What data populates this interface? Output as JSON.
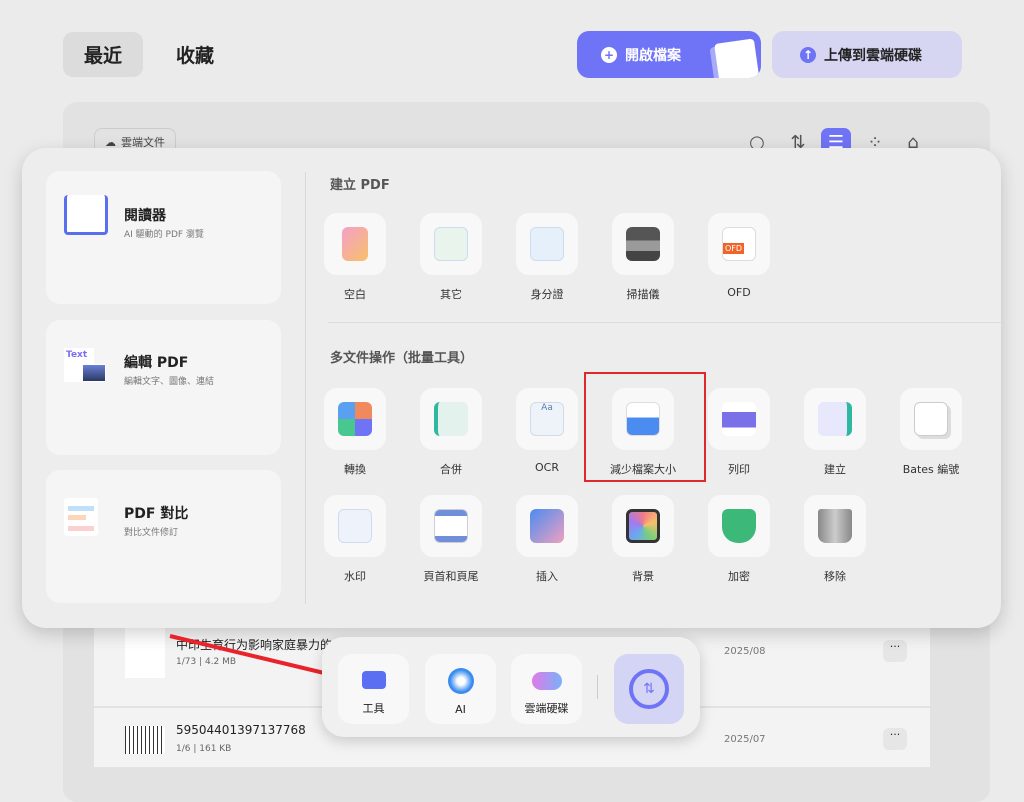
{
  "tabs": {
    "recent": "最近",
    "favorites": "收藏"
  },
  "header": {
    "open_file": "開啟檔案",
    "upload_cloud": "上傳到雲端硬碟"
  },
  "filter": {
    "cloud_docs": "雲端文件"
  },
  "left_cards": [
    {
      "title": "閱讀器",
      "subtitle": "AI 驅動的 PDF 瀏覽"
    },
    {
      "title": "編輯 PDF",
      "subtitle": "編輯文字、圖像、連結",
      "icon_text": "Text"
    },
    {
      "title": "PDF 對比",
      "subtitle": "對比文件修訂"
    }
  ],
  "create_section": {
    "title": "建立 PDF",
    "items": [
      "空白",
      "其它",
      "身分證",
      "掃描儀",
      "OFD"
    ],
    "ofd_badge": "OFD"
  },
  "batch_section": {
    "title": "多文件操作（批量工具）",
    "row1": [
      "轉換",
      "合併",
      "OCR",
      "減少檔案大小",
      "列印",
      "建立",
      "Bates 編號"
    ],
    "row2": [
      "水印",
      "頁首和頁尾",
      "插入",
      "背景",
      "加密",
      "移除"
    ],
    "highlighted": "減少檔案大小"
  },
  "files": [
    {
      "title": "中印生育行为影响家庭暴力的经…",
      "meta": "1/73 | 4.2 MB",
      "date": "2025/08"
    },
    {
      "title": "59504401397137768",
      "meta": "1/6 | 161 KB",
      "date": "2025/07"
    }
  ],
  "dock": {
    "tools": "工具",
    "ai": "AI",
    "cloud": "雲端硬碟"
  },
  "colors": {
    "accent": "#6f73f5",
    "highlight": "#e0282a",
    "annotation": "#e8242a"
  }
}
